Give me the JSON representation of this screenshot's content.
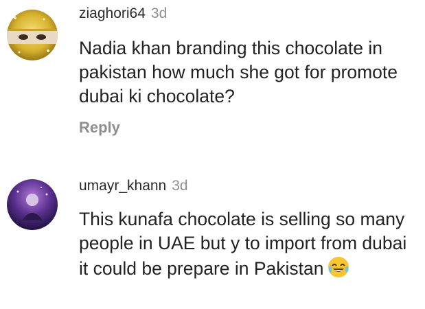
{
  "comments": [
    {
      "username": "ziaghori64",
      "time": "3d",
      "text": "Nadia khan branding this chocolate in pakistan how much she got for promote dubai ki chocolate?",
      "reply_label": "Reply",
      "avatar_icon": "profile-photo-gold-glitter"
    },
    {
      "username": "umayr_khann",
      "time": "3d",
      "text": "This kunafa chocolate is selling so many people in UAE but y to import from dubai it could be prepare in Pakistan",
      "emoji_icon": "face-with-tears-of-joy-emoji",
      "avatar_icon": "profile-photo-purple-night"
    }
  ]
}
